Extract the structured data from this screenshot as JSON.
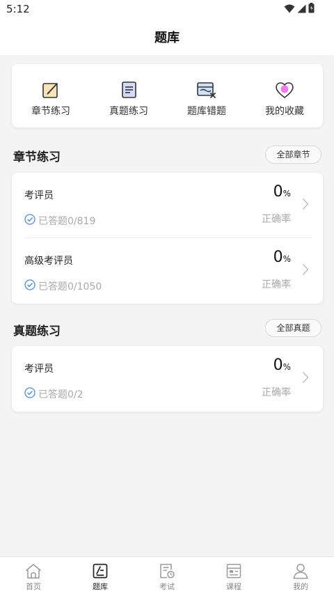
{
  "status_bar": {
    "time": "5:12"
  },
  "header": {
    "title": "题库"
  },
  "quick_links": [
    {
      "label": "章节练习",
      "icon": "chapter-edit-icon"
    },
    {
      "label": "真题练习",
      "icon": "paper-document-icon"
    },
    {
      "label": "题库错题",
      "icon": "wrong-answers-icon"
    },
    {
      "label": "我的收藏",
      "icon": "heart-favorite-icon"
    }
  ],
  "chapter_section": {
    "title": "章节练习",
    "all_button": "全部章节",
    "items": [
      {
        "name": "考评员",
        "progress": "已答题0/819",
        "percent": "0",
        "percent_unit": "%",
        "accuracy_label": "正确率"
      },
      {
        "name": "高级考评员",
        "progress": "已答题0/1050",
        "percent": "0",
        "percent_unit": "%",
        "accuracy_label": "正确率"
      }
    ]
  },
  "real_section": {
    "title": "真题练习",
    "all_button": "全部真题",
    "items": [
      {
        "name": "考评员",
        "progress": "已答题0/2",
        "percent": "0",
        "percent_unit": "%",
        "accuracy_label": "正确率"
      }
    ]
  },
  "bottom_nav": [
    {
      "label": "首页",
      "icon": "home-icon",
      "active": false
    },
    {
      "label": "题库",
      "icon": "question-bank-icon",
      "active": true
    },
    {
      "label": "考试",
      "icon": "exam-icon",
      "active": false
    },
    {
      "label": "课程",
      "icon": "course-icon",
      "active": false
    },
    {
      "label": "我的",
      "icon": "profile-icon",
      "active": false
    }
  ],
  "colors": {
    "accent_blue": "#4a8de8",
    "heart_pink": "#f07cf0",
    "text_dark": "#222222",
    "text_muted": "#aaaaaa"
  }
}
